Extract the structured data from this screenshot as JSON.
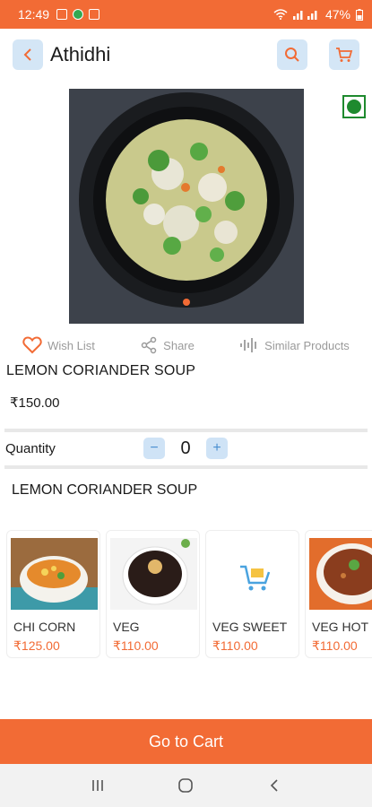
{
  "status_bar": {
    "time": "12:49",
    "battery": "47%"
  },
  "app_bar": {
    "title": "Athidhi"
  },
  "product": {
    "name": "LEMON CORIANDER SOUP",
    "price": "₹150.00",
    "description": "LEMON CORIANDER SOUP",
    "is_veg": true
  },
  "actions": {
    "wishlist": "Wish List",
    "share": "Share",
    "similar": "Similar Products"
  },
  "quantity": {
    "label": "Quantity",
    "minus": "−",
    "value": "0",
    "plus": "+"
  },
  "recommendations": [
    {
      "name": "CHI CORN",
      "price": "₹125.00"
    },
    {
      "name": "VEG",
      "price": "₹110.00"
    },
    {
      "name": "VEG SWEET",
      "price": "₹110.00"
    },
    {
      "name": "VEG HOT",
      "price": "₹110.00"
    }
  ],
  "cta": {
    "label": "Go to Cart"
  },
  "colors": {
    "accent": "#f26b35",
    "veg_green": "#1e8a2e",
    "icon_bg": "#d4e6f6"
  }
}
